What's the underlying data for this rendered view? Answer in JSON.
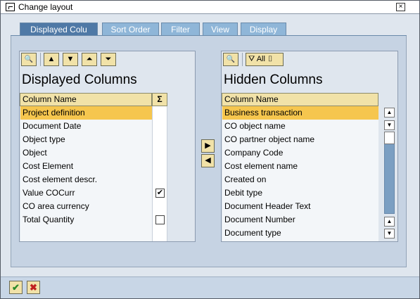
{
  "window": {
    "title": "Change layout",
    "close_glyph": "×"
  },
  "tabs": [
    {
      "label": "Displayed Colu",
      "active": true
    },
    {
      "label": "Sort Order",
      "active": false
    },
    {
      "label": "Filter",
      "active": false
    },
    {
      "label": "View",
      "active": false
    },
    {
      "label": "Display",
      "active": false
    }
  ],
  "left": {
    "title": "Displayed Columns",
    "column_header": "Column Name",
    "sum_glyph": "Σ",
    "rows": [
      {
        "label": "Project definition",
        "selected": true,
        "checkbox": null
      },
      {
        "label": "Document Date",
        "selected": false,
        "checkbox": null
      },
      {
        "label": "Object type",
        "selected": false,
        "checkbox": null
      },
      {
        "label": "Object",
        "selected": false,
        "checkbox": null
      },
      {
        "label": "Cost Element",
        "selected": false,
        "checkbox": null
      },
      {
        "label": "Cost element descr.",
        "selected": false,
        "checkbox": null
      },
      {
        "label": "Value COCurr",
        "selected": false,
        "checkbox": true
      },
      {
        "label": "CO area currency",
        "selected": false,
        "checkbox": null
      },
      {
        "label": "Total Quantity",
        "selected": false,
        "checkbox": false
      }
    ],
    "toolbar": {
      "find": "🔍",
      "up": "▲",
      "down": "▼",
      "top": "⏶",
      "bottom": "⏷"
    }
  },
  "right": {
    "title": "Hidden Columns",
    "column_header": "Column Name",
    "filter_label": "All",
    "rows": [
      {
        "label": "Business transaction",
        "selected": true
      },
      {
        "label": "CO object name",
        "selected": false
      },
      {
        "label": "CO partner object name",
        "selected": false
      },
      {
        "label": "Company Code",
        "selected": false
      },
      {
        "label": "Cost element name",
        "selected": false
      },
      {
        "label": "Created on",
        "selected": false
      },
      {
        "label": "Debit type",
        "selected": false
      },
      {
        "label": "Document Header Text",
        "selected": false
      },
      {
        "label": "Document Number",
        "selected": false
      },
      {
        "label": "Document type",
        "selected": false
      }
    ]
  },
  "move": {
    "right": "▶",
    "left": "◀"
  },
  "bottom": {
    "ok": "✔",
    "cancel": "✖"
  },
  "colors": {
    "accent": "#4f79a6",
    "selection": "#f6c64e",
    "button": "#f1e2a8"
  }
}
